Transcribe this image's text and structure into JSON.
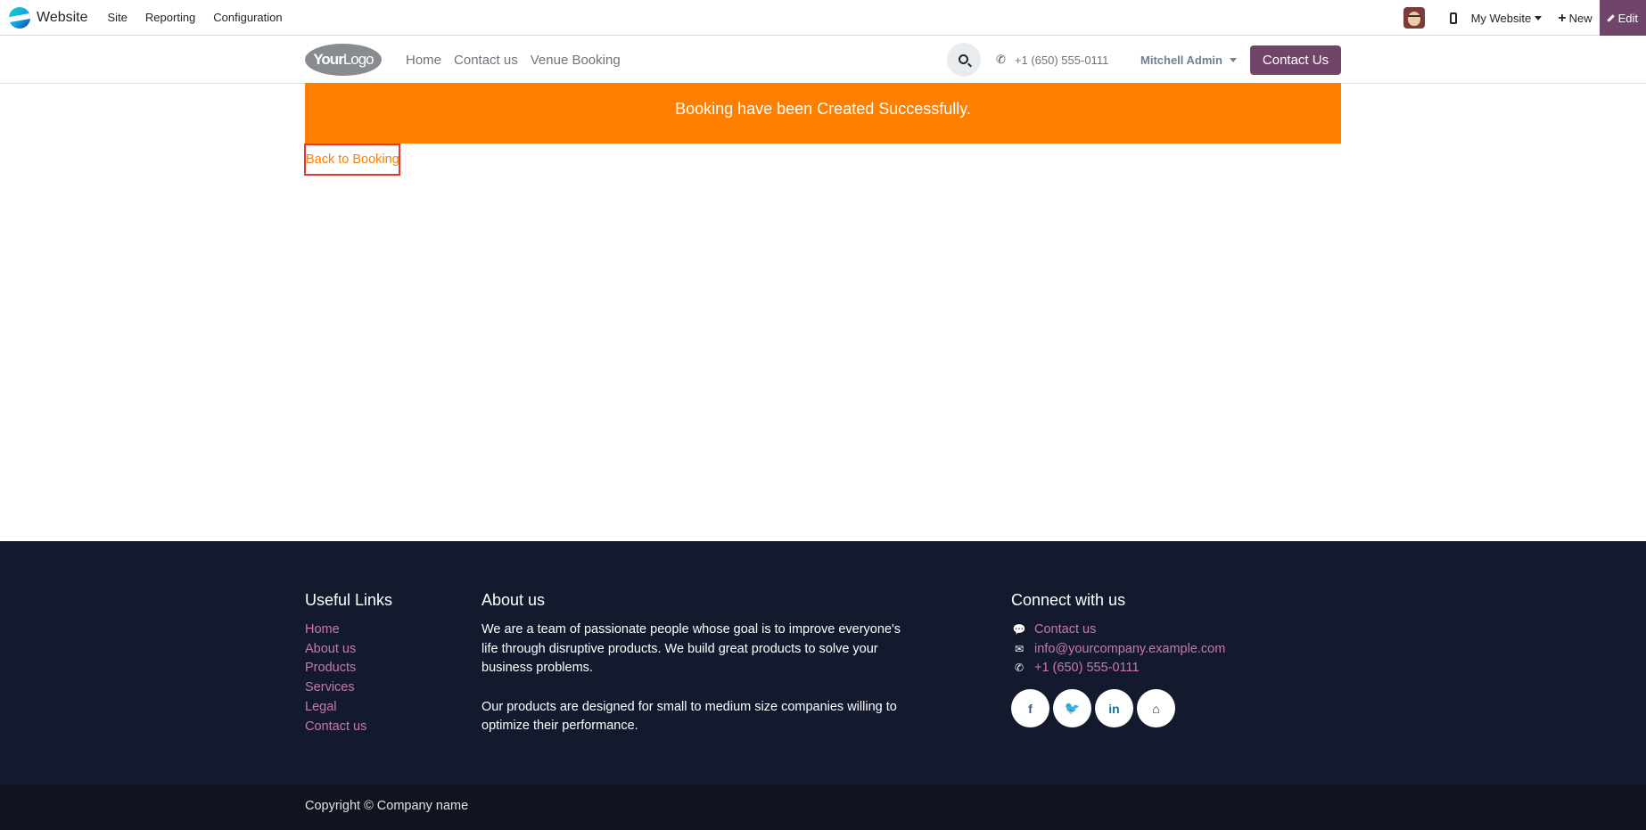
{
  "adminbar": {
    "app_name": "Website",
    "menu": [
      "Site",
      "Reporting",
      "Configuration"
    ],
    "website_selector": "My Website",
    "new_label": "New",
    "edit_label": "Edit"
  },
  "header": {
    "logo_bold": "Your",
    "logo_light": "Logo",
    "nav": [
      "Home",
      "Contact us",
      "Venue Booking"
    ],
    "phone": "+1 (650) 555-0111",
    "user": "Mitchell Admin",
    "contact_button": "Contact Us"
  },
  "main": {
    "alert_text": "Booking have been Created Successfully.",
    "back_link": "Back to Booking"
  },
  "footer": {
    "useful_links_title": "Useful Links",
    "useful_links": [
      "Home",
      "About us",
      "Products",
      "Services",
      "Legal",
      "Contact us"
    ],
    "about_title": "About us",
    "about_p1": "We are a team of passionate people whose goal is to improve everyone's life through disruptive products. We build great products to solve your business problems.",
    "about_p2": "Our products are designed for small to medium size companies willing to optimize their performance.",
    "connect_title": "Connect with us",
    "connect": {
      "contact": "Contact us",
      "email": "info@yourcompany.example.com",
      "phone": "+1 (650) 555-0111"
    },
    "socials": [
      {
        "icon": "facebook-icon",
        "glyph": "f",
        "color": "#3b5998"
      },
      {
        "icon": "twitter-icon",
        "glyph": "🐦",
        "color": "#1da1f2"
      },
      {
        "icon": "linkedin-icon",
        "glyph": "in",
        "color": "#0e76a8"
      },
      {
        "icon": "home-icon",
        "glyph": "⌂",
        "color": "#212529"
      }
    ],
    "copyright": "Copyright © Company name"
  },
  "colors": {
    "brand": "#71456a",
    "alert": "#ff7f00",
    "footer_bg": "#141a2e",
    "link": "#c879a9"
  }
}
